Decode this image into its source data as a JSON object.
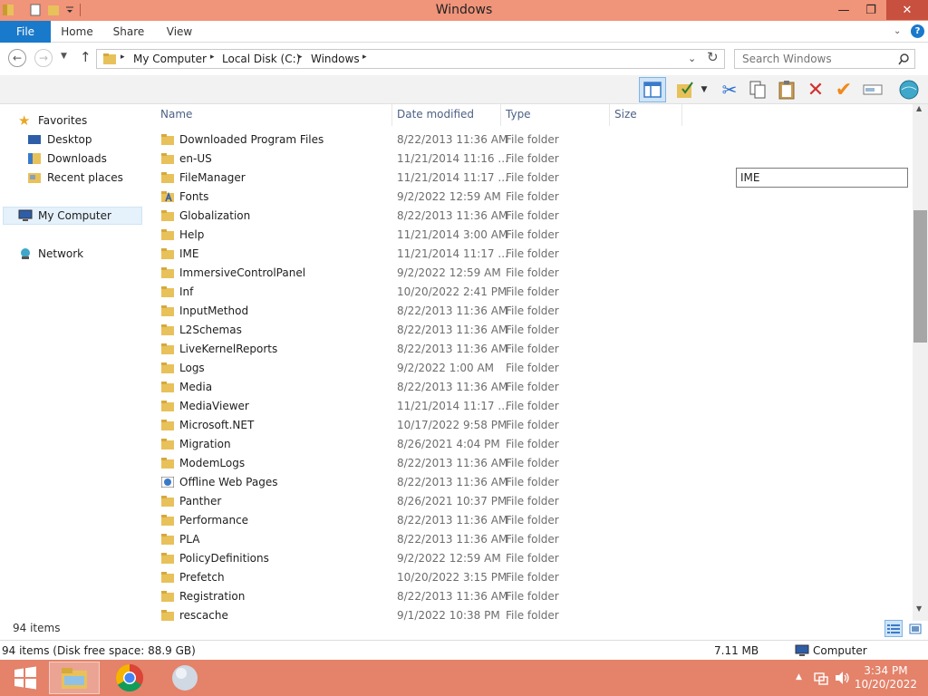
{
  "window": {
    "title": "Windows"
  },
  "ribbon": {
    "tabs": [
      {
        "label": "File"
      },
      {
        "label": "Home"
      },
      {
        "label": "Share"
      },
      {
        "label": "View"
      }
    ]
  },
  "address": {
    "breadcrumbs": [
      "My Computer",
      "Local Disk (C:)",
      "Windows"
    ],
    "search_placeholder": "Search Windows"
  },
  "navpane": {
    "favorites": "Favorites",
    "desktop": "Desktop",
    "downloads": "Downloads",
    "recent": "Recent places",
    "mycomputer": "My Computer",
    "network": "Network"
  },
  "columns": {
    "name": "Name",
    "date": "Date modified",
    "type": "Type",
    "size": "Size"
  },
  "rename_value": "IME",
  "files": [
    {
      "name": "Downloaded Program Files",
      "date": "8/22/2013 11:36 AM",
      "type": "File folder",
      "icon": "folder-icon"
    },
    {
      "name": "en-US",
      "date": "11/21/2014 11:16 ...",
      "type": "File folder",
      "icon": "folder-icon"
    },
    {
      "name": "FileManager",
      "date": "11/21/2014 11:17 ...",
      "type": "File folder",
      "icon": "folder-icon"
    },
    {
      "name": "Fonts",
      "date": "9/2/2022 12:59 AM",
      "type": "File folder",
      "icon": "fonts-folder-icon"
    },
    {
      "name": "Globalization",
      "date": "8/22/2013 11:36 AM",
      "type": "File folder",
      "icon": "folder-icon"
    },
    {
      "name": "Help",
      "date": "11/21/2014 3:00 AM",
      "type": "File folder",
      "icon": "folder-icon"
    },
    {
      "name": "IME",
      "date": "11/21/2014 11:17 ...",
      "type": "File folder",
      "icon": "folder-icon"
    },
    {
      "name": "ImmersiveControlPanel",
      "date": "9/2/2022 12:59 AM",
      "type": "File folder",
      "icon": "folder-icon"
    },
    {
      "name": "Inf",
      "date": "10/20/2022 2:41 PM",
      "type": "File folder",
      "icon": "folder-icon"
    },
    {
      "name": "InputMethod",
      "date": "8/22/2013 11:36 AM",
      "type": "File folder",
      "icon": "folder-icon"
    },
    {
      "name": "L2Schemas",
      "date": "8/22/2013 11:36 AM",
      "type": "File folder",
      "icon": "folder-icon"
    },
    {
      "name": "LiveKernelReports",
      "date": "8/22/2013 11:36 AM",
      "type": "File folder",
      "icon": "folder-icon"
    },
    {
      "name": "Logs",
      "date": "9/2/2022 1:00 AM",
      "type": "File folder",
      "icon": "folder-icon"
    },
    {
      "name": "Media",
      "date": "8/22/2013 11:36 AM",
      "type": "File folder",
      "icon": "folder-icon"
    },
    {
      "name": "MediaViewer",
      "date": "11/21/2014 11:17 ...",
      "type": "File folder",
      "icon": "folder-icon"
    },
    {
      "name": "Microsoft.NET",
      "date": "10/17/2022 9:58 PM",
      "type": "File folder",
      "icon": "folder-icon"
    },
    {
      "name": "Migration",
      "date": "8/26/2021 4:04 PM",
      "type": "File folder",
      "icon": "folder-icon"
    },
    {
      "name": "ModemLogs",
      "date": "8/22/2013 11:36 AM",
      "type": "File folder",
      "icon": "folder-icon"
    },
    {
      "name": "Offline Web Pages",
      "date": "8/22/2013 11:36 AM",
      "type": "File folder",
      "icon": "offline-pages-icon"
    },
    {
      "name": "Panther",
      "date": "8/26/2021 10:37 PM",
      "type": "File folder",
      "icon": "folder-icon"
    },
    {
      "name": "Performance",
      "date": "8/22/2013 11:36 AM",
      "type": "File folder",
      "icon": "folder-icon"
    },
    {
      "name": "PLA",
      "date": "8/22/2013 11:36 AM",
      "type": "File folder",
      "icon": "folder-icon"
    },
    {
      "name": "PolicyDefinitions",
      "date": "9/2/2022 12:59 AM",
      "type": "File folder",
      "icon": "folder-icon"
    },
    {
      "name": "Prefetch",
      "date": "10/20/2022 3:15 PM",
      "type": "File folder",
      "icon": "folder-icon"
    },
    {
      "name": "Registration",
      "date": "8/22/2013 11:36 AM",
      "type": "File folder",
      "icon": "folder-icon"
    },
    {
      "name": "rescache",
      "date": "9/1/2022 10:38 PM",
      "type": "File folder",
      "icon": "folder-icon"
    }
  ],
  "status": {
    "item_count": "94 items",
    "detail": "94 items (Disk free space: 88.9 GB)",
    "size": "7.11 MB",
    "location": "Computer"
  },
  "taskbar": {
    "time": "3:34 PM",
    "date": "10/20/2022"
  },
  "colors": {
    "title_bar": "#f0947a",
    "taskbar": "#e4826a",
    "file_tab": "#1979ca",
    "close_button": "#c7503e",
    "folder": "#e8c15a"
  }
}
